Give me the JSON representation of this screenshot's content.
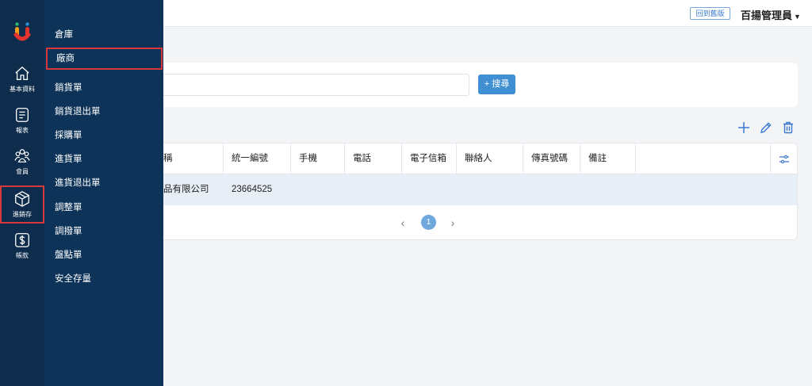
{
  "rail": {
    "items": [
      {
        "label": "基本資料",
        "icon": "home-icon"
      },
      {
        "label": "報表",
        "icon": "report-icon"
      },
      {
        "label": "會員",
        "icon": "members-icon"
      },
      {
        "label": "進銷存",
        "icon": "box-icon"
      },
      {
        "label": "帳款",
        "icon": "dollar-icon"
      }
    ]
  },
  "submenu": {
    "items": [
      {
        "label": "倉庫"
      },
      {
        "label": "廠商"
      },
      {
        "label": "銷貨單"
      },
      {
        "label": "銷貨退出單"
      },
      {
        "label": "採購單"
      },
      {
        "label": "進貨單"
      },
      {
        "label": "進貨退出單"
      },
      {
        "label": "調整單"
      },
      {
        "label": "調撥單"
      },
      {
        "label": "盤點單"
      },
      {
        "label": "安全存量"
      }
    ]
  },
  "topbar": {
    "legacy_label": "回到舊版",
    "user_name": "百揚管理員"
  },
  "search": {
    "button_label": "+ 搜尋",
    "value": ""
  },
  "table": {
    "headers": [
      "稱",
      "統一編號",
      "手機",
      "電話",
      "電子信箱",
      "聯絡人",
      "傳真號碼",
      "備註"
    ],
    "rows": [
      {
        "name": "品有限公司",
        "tax_id": "23664525"
      }
    ]
  },
  "pager": {
    "current": "1"
  },
  "colors": {
    "rail_bg": "#0e2d4c",
    "submenu_bg": "#0d3358",
    "accent": "#3f8fd2",
    "highlight": "#d9383a"
  }
}
